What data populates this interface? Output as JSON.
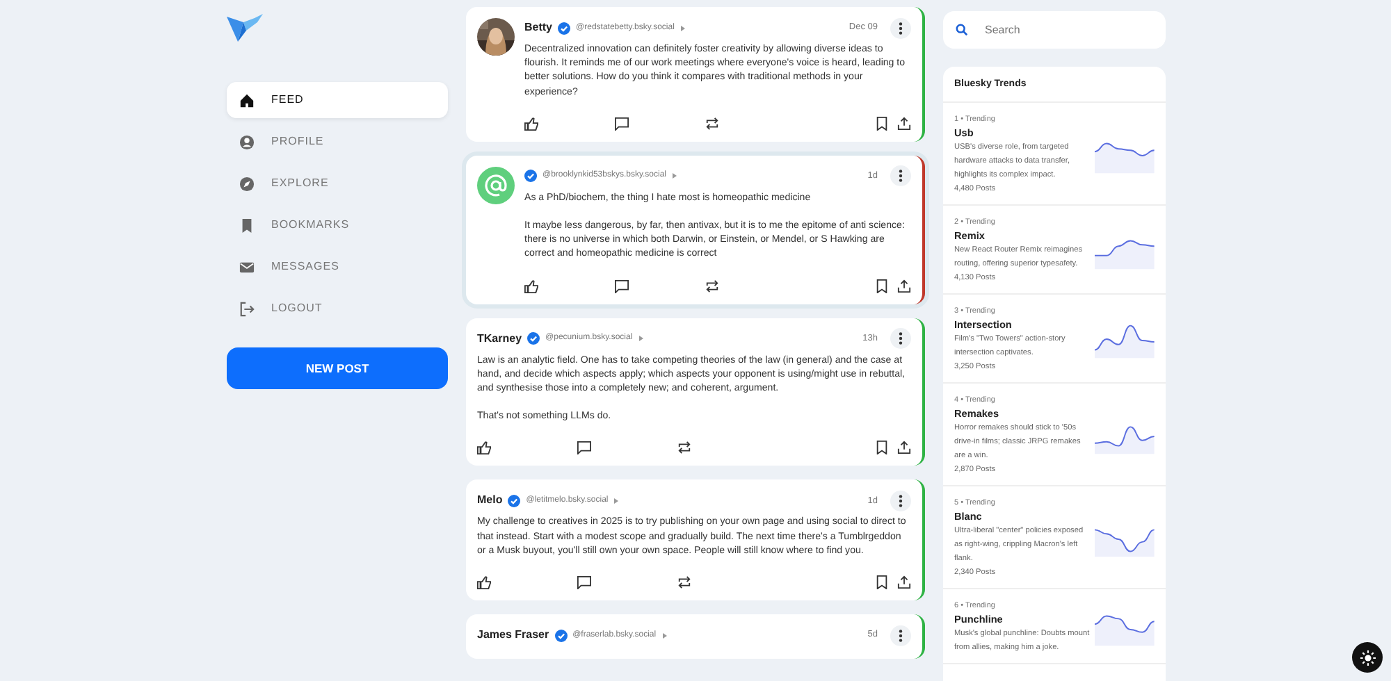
{
  "nav": {
    "items": [
      {
        "label": "FEED",
        "selected": true
      },
      {
        "label": "PROFILE",
        "selected": false
      },
      {
        "label": "EXPLORE",
        "selected": false
      },
      {
        "label": "BOOKMARKS",
        "selected": false
      },
      {
        "label": "MESSAGES",
        "selected": false
      },
      {
        "label": "LOGOUT",
        "selected": false
      }
    ],
    "new_post_button": "NEW POST"
  },
  "posts": [
    {
      "name": "Betty",
      "verified": true,
      "handle": "@redstatebetty.bsky.social",
      "time": "Dec 09",
      "selected": false,
      "color": "#2fb344",
      "paragraphs": [
        "Decentralized innovation can definitely foster creativity by allowing diverse ideas to flourish. It reminds me of our work meetings where everyone's voice is heard, leading to better solutions. How do you think it compares with traditional methods in your experience?"
      ]
    },
    {
      "kind": "at",
      "verified": true,
      "handle": "@brooklynkid53bskys.bsky.social",
      "time": "1d",
      "selected": true,
      "color": "#c0392b",
      "paragraphs": [
        "As a PhD/biochem, the thing I hate most is homeopathic medicine",
        "It maybe less dangerous, by far, then antivax, but it is to me the epitome of anti science: there is no universe in which both Darwin, or Einstein, or Mendel, or S Hawking are correct and homeopathic medicine is correct"
      ]
    },
    {
      "kind": "plain",
      "name": "TKarney",
      "verified": true,
      "handle": "@pecunium.bsky.social",
      "time": "13h",
      "selected": false,
      "color": "#2fb344",
      "paragraphs": [
        "Law is an analytic field. One has to take competing theories of the law (in general) and the case at hand, and decide which aspects apply; which aspects your opponent is using/might use in rebuttal, and synthesise those into a completely new; and coherent, argument.",
        "That's not something LLMs do."
      ]
    },
    {
      "kind": "plain",
      "name": "Melo",
      "verified": true,
      "handle": "@letitmelo.bsky.social",
      "time": "1d",
      "selected": false,
      "color": "#2fb344",
      "paragraphs": [
        "My challenge to creatives in 2025 is to try publishing on your own page and using social to direct to that instead. Start with a modest scope and gradually build. The next time there's a Tumblrgeddon or a Musk buyout, you'll still own your own space. People will still know where to find you."
      ]
    },
    {
      "kind": "plain",
      "name": "James Fraser",
      "verified": true,
      "handle": "@fraserlab.bsky.social",
      "time": "5d",
      "selected": false,
      "color": "#2fb344"
    }
  ],
  "search": {
    "placeholder": "Search"
  },
  "trends": {
    "title": "Bluesky Trends",
    "items": [
      {
        "rank": "1 • Trending",
        "topic": "Usb",
        "description": "USB's diverse role, from targeted hardware attacks to data transfer, highlights its complex impact.",
        "posts": "4,480 Posts"
      },
      {
        "rank": "2 • Trending",
        "topic": "Remix",
        "description": "New React Router Remix reimagines routing, offering superior typesafety.",
        "posts": "4,130 Posts"
      },
      {
        "rank": "3 • Trending",
        "topic": "Intersection",
        "description": "Film's \"Two Towers\" action-story intersection captivates.",
        "posts": "3,250 Posts"
      },
      {
        "rank": "4 • Trending",
        "topic": "Remakes",
        "description": "Horror remakes should stick to '50s drive-in films; classic JRPG remakes are a win.",
        "posts": "2,870 Posts"
      },
      {
        "rank": "5 • Trending",
        "topic": "Blanc",
        "description": "Ultra-liberal \"center\" policies exposed as right-wing, crippling Macron's left flank.",
        "posts": "2,340 Posts"
      },
      {
        "rank": "6 • Trending",
        "topic": "Punchline",
        "description": "Musk's global punchline: Doubts mount from allies, making him a joke."
      }
    ]
  }
}
